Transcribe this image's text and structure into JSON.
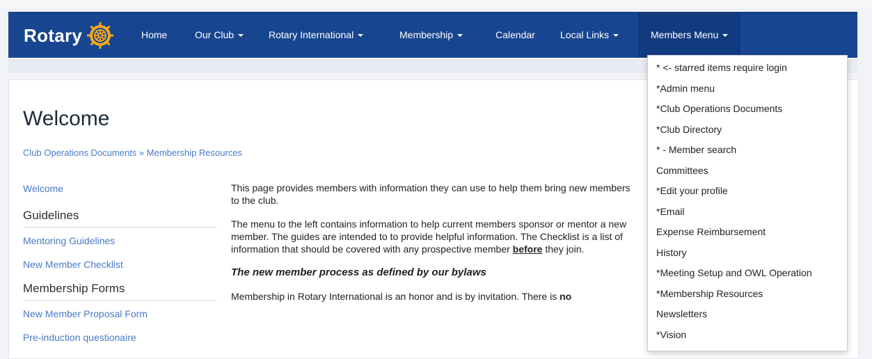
{
  "navbar": {
    "brand": "Rotary",
    "items": [
      {
        "label": "Home",
        "dropdown": false
      },
      {
        "label": "Our Club",
        "dropdown": true
      },
      {
        "label": "Rotary International",
        "dropdown": true
      },
      {
        "label": "Membership",
        "dropdown": true
      },
      {
        "label": "Calendar",
        "dropdown": false
      },
      {
        "label": "Local Links",
        "dropdown": true
      },
      {
        "label": "Members Menu",
        "dropdown": true
      }
    ]
  },
  "members_menu": {
    "items": [
      "* <- starred items require login",
      "*Admin menu",
      "*Club Operations Documents",
      "*Club Directory",
      "* - Member search",
      "Committees",
      "*Edit your profile",
      "*Email",
      "Expense Reimbursement",
      "History",
      "*Meeting Setup and OWL Operation",
      "*Membership Resources",
      "Newsletters",
      "*Vision"
    ]
  },
  "page": {
    "title": "Welcome",
    "breadcrumb": {
      "parent": "Club Operations Documents",
      "separator": " » ",
      "current": "Membership Resources"
    }
  },
  "sidebar": {
    "welcome_link": "Welcome",
    "guidelines_heading": "Guidelines",
    "guidelines_links": [
      "Mentoring Guidelines",
      "New Member Checklist"
    ],
    "forms_heading": "Membership Forms",
    "forms_links": [
      "New Member Proposal Form",
      "Pre-induction questionaire"
    ]
  },
  "content": {
    "p1": "This page provides members with information they can use to help them bring new members to the club.",
    "p2_start": "The menu to the left contains information to help current members sponsor or mentor a new member. The guides are intended to to provide helpful information. The Checklist is a list of information that should be covered with any prospective member ",
    "p2_emph": "before",
    "p2_end": " they join.",
    "heading": "The new member process as defined by our bylaws",
    "p3_start": "Membership in Rotary International is an honor and is by invitation. There is ",
    "p3_emph": "no"
  },
  "colors": {
    "navbar": "#17458f",
    "link": "#4a79c6",
    "rotary_gold": "#f7a81b"
  }
}
